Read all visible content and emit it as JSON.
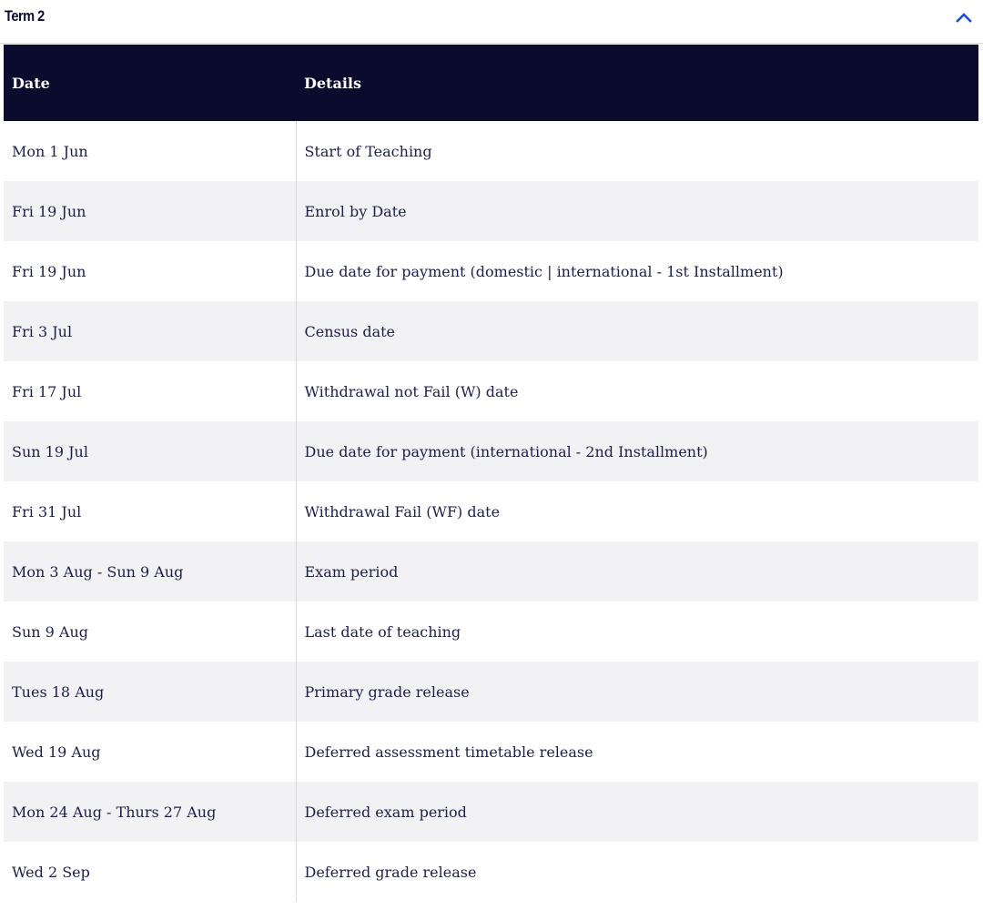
{
  "accordion": {
    "title": "Term 2",
    "toggle_icon": "chevron-up-icon",
    "accent_color": "#1d4fd6"
  },
  "table": {
    "header_color": "#0b0b2e",
    "columns": [
      "Date",
      "Details"
    ],
    "rows": [
      {
        "date": "Mon 1 Jun",
        "details": "Start of Teaching"
      },
      {
        "date": "Fri 19 Jun",
        "details": "Enrol by Date"
      },
      {
        "date": "Fri 19 Jun",
        "details": "Due date for payment (domestic | international - 1st Installment)"
      },
      {
        "date": "Fri 3 Jul",
        "details": "Census date"
      },
      {
        "date": "Fri 17 Jul",
        "details": "Withdrawal not Fail (W) date"
      },
      {
        "date": "Sun 19 Jul",
        "details": "Due date for payment (international - 2nd Installment)"
      },
      {
        "date": "Fri 31 Jul",
        "details": "Withdrawal Fail (WF) date"
      },
      {
        "date": "Mon 3 Aug - Sun 9 Aug",
        "details": "Exam period"
      },
      {
        "date": "Sun 9 Aug",
        "details": "Last date of teaching"
      },
      {
        "date": "Tues 18 Aug",
        "details": "Primary grade release"
      },
      {
        "date": "Wed 19 Aug",
        "details": "Deferred assessment timetable release"
      },
      {
        "date": "Mon 24 Aug - Thurs 27 Aug",
        "details": "Deferred exam period"
      },
      {
        "date": "Wed 2 Sep",
        "details": "Deferred grade release"
      }
    ]
  }
}
